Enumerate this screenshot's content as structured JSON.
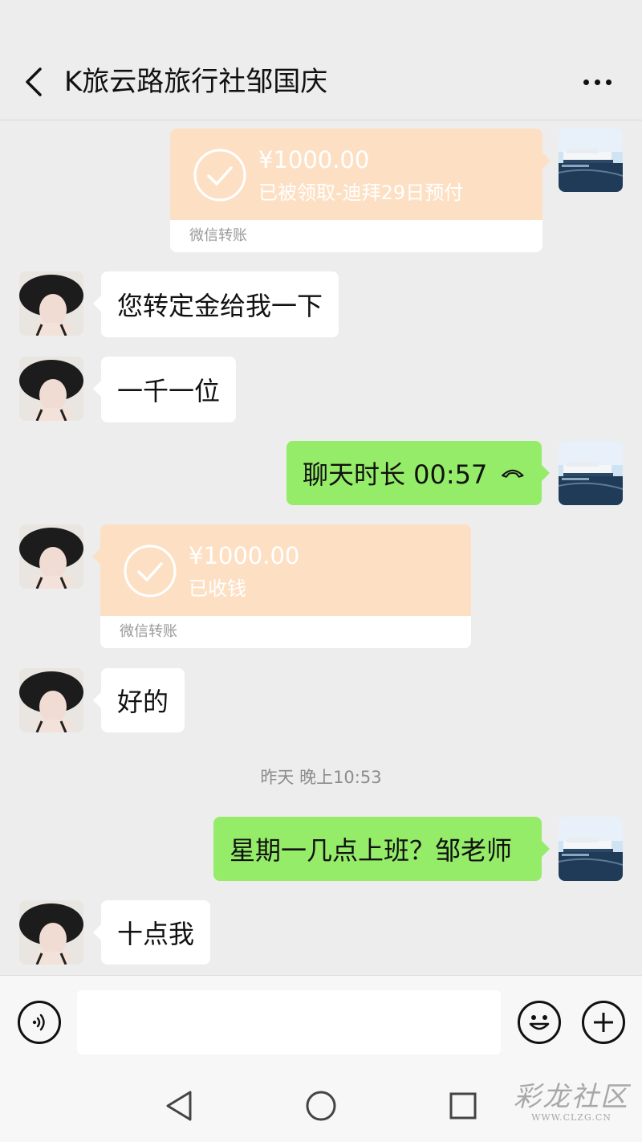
{
  "header": {
    "title": "K旅云路旅行社邹国庆"
  },
  "messages": [
    {
      "kind": "transfer",
      "direction": "out",
      "amount": "¥1000.00",
      "desc": "已被领取-迪拜29日预付",
      "footer": "微信转账"
    },
    {
      "kind": "text",
      "direction": "in",
      "text": "您转定金给我一下"
    },
    {
      "kind": "text",
      "direction": "in",
      "text": "一千一位"
    },
    {
      "kind": "call",
      "direction": "out",
      "text": "聊天时长 00:57"
    },
    {
      "kind": "transfer",
      "direction": "in",
      "amount": "¥1000.00",
      "desc": "已收钱",
      "footer": "微信转账"
    },
    {
      "kind": "text",
      "direction": "in",
      "text": "好的"
    },
    {
      "kind": "timestamp",
      "text": "昨天 晚上10:53"
    },
    {
      "kind": "text",
      "direction": "out",
      "text": "星期一几点上班？邹老师"
    },
    {
      "kind": "text",
      "direction": "in",
      "text": "十点我"
    }
  ],
  "input": {
    "value": ""
  },
  "icons": {
    "back": "chevron-left-icon",
    "more": "more-dots-icon",
    "voice": "voice-icon",
    "emoji": "emoji-icon",
    "plus": "plus-icon",
    "call": "phone-hangup-icon",
    "check": "check-circle-icon",
    "nav_back": "triangle-back-icon",
    "nav_home": "circle-home-icon",
    "nav_recent": "square-recent-icon"
  },
  "colors": {
    "outgoing_bubble": "#95ec69",
    "incoming_bubble": "#ffffff",
    "transfer_card": "#fde0c4",
    "background": "#ededed"
  },
  "watermark": {
    "main": "彩龙社区",
    "sub": "WWW.CLZG.CN"
  }
}
